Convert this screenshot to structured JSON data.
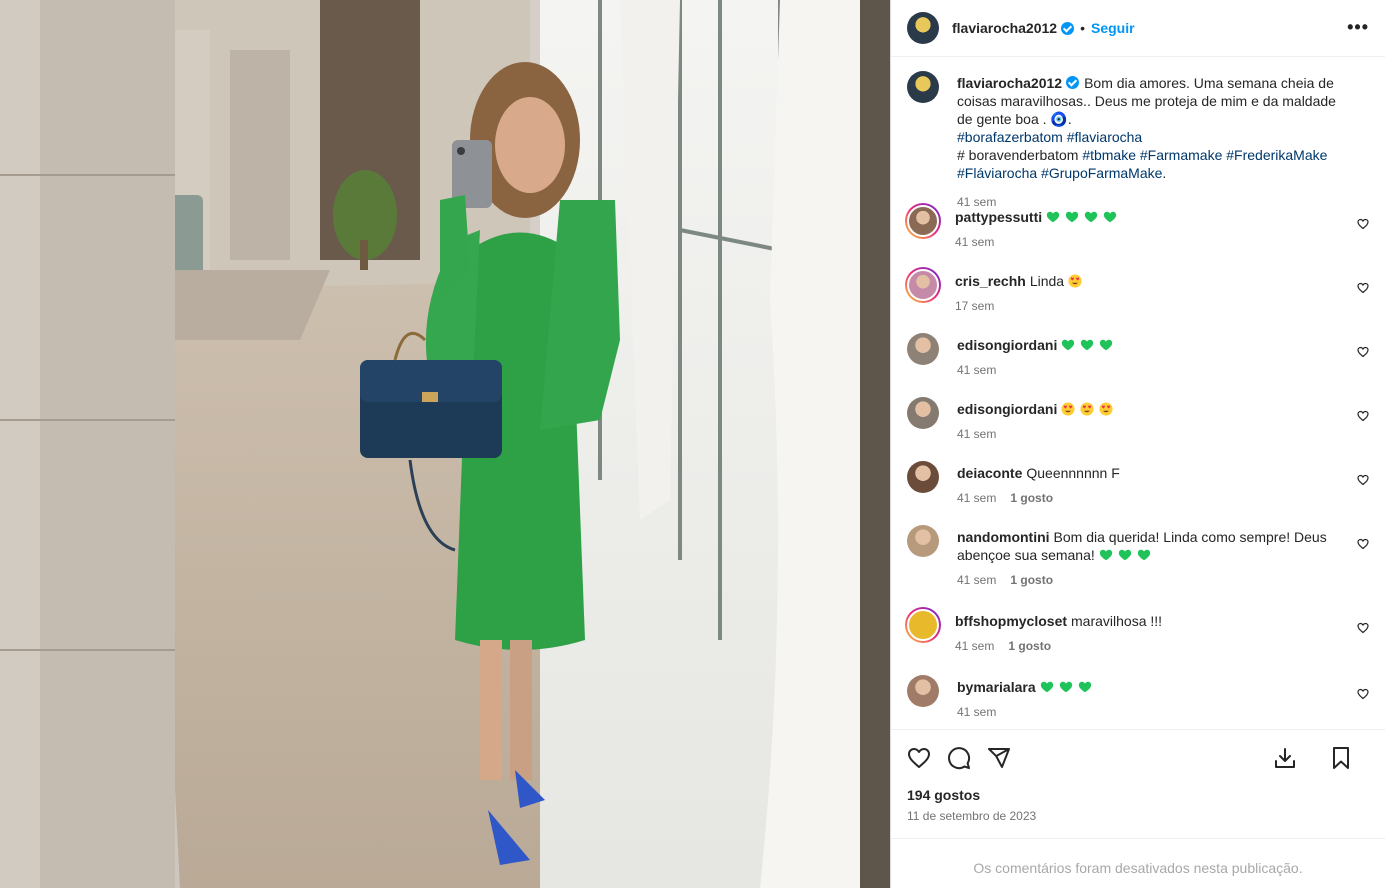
{
  "post": {
    "author": "flaviarocha2012",
    "dot": "•",
    "follow_label": "Seguir",
    "more_label": "•••",
    "photo_alt": "Woman in green dress taking mirror selfie with navy handbag in a hallway"
  },
  "caption": {
    "user": "flaviarocha2012",
    "text": "Bom dia amores. Uma semana cheia de coisas maravilhosas.. Deus me proteja de mim e da maldade de gente boa . 🧿.",
    "line2_tags": "#borafazerbatom #flaviarocha",
    "line3_prefix": "# boravenderbatom",
    "line3_tags": "#tbmake #Farmamake #FrederikaMake",
    "line4_tags": "#Fláviarocha #GrupoFarmaMake",
    "line4_suffix": ".",
    "time": "41 sem"
  },
  "comments": [
    {
      "user": "pattypessutti",
      "text": "",
      "emoji": [
        "green-heart",
        "green-heart",
        "green-heart",
        "green-heart"
      ],
      "time": "41 sem",
      "likes": "",
      "avatar_color": "#8a6a55",
      "ring": true
    },
    {
      "user": "cris_rechh",
      "text": "Linda",
      "emoji": [
        "heart-eyes"
      ],
      "time": "17 sem",
      "likes": "",
      "avatar_color": "#c58aa8",
      "ring": true
    },
    {
      "user": "edisongiordani",
      "text": "",
      "emoji": [
        "green-heart",
        "green-heart",
        "green-heart"
      ],
      "time": "41 sem",
      "likes": "",
      "avatar_color": "#8e8276",
      "ring": false
    },
    {
      "user": "edisongiordani",
      "text": "",
      "emoji": [
        "heart-eyes",
        "heart-eyes",
        "heart-eyes"
      ],
      "time": "41 sem",
      "likes": "",
      "avatar_color": "#857a70",
      "ring": false
    },
    {
      "user": "deiaconte",
      "text": "Queennnnnn F",
      "emoji": [],
      "time": "41 sem",
      "likes": "1 gosto",
      "avatar_color": "#6b4c3b",
      "ring": false
    },
    {
      "user": "nandomontini",
      "text": "Bom dia querida! Linda como sempre! Deus abençoe sua semana!",
      "emoji": [
        "green-heart",
        "green-heart",
        "green-heart"
      ],
      "time": "41 sem",
      "likes": "1 gosto",
      "avatar_color": "#b79a7c",
      "ring": false
    },
    {
      "user": "bffshopmycloset",
      "text": "maravilhosa !!!",
      "emoji": [],
      "time": "41 sem",
      "likes": "1 gosto",
      "avatar_color": "#e8b92a",
      "ring": true
    },
    {
      "user": "bymarialara",
      "text": "",
      "emoji": [
        "green-heart",
        "green-heart",
        "green-heart"
      ],
      "time": "41 sem",
      "likes": "",
      "avatar_color": "#a07c68",
      "ring": false
    }
  ],
  "footer": {
    "likes": "194 gostos",
    "date": "11 de setembro de 2023",
    "disabled": "Os comentários foram desativados nesta publicação."
  },
  "icons": {
    "like": "heart-icon",
    "comment": "comment-icon",
    "share": "share-icon",
    "download": "download-icon",
    "save": "bookmark-icon"
  },
  "colors": {
    "accent": "#0095f6",
    "hashtag": "#00376b",
    "muted": "#737373",
    "green_heart": "#1fc35a"
  }
}
